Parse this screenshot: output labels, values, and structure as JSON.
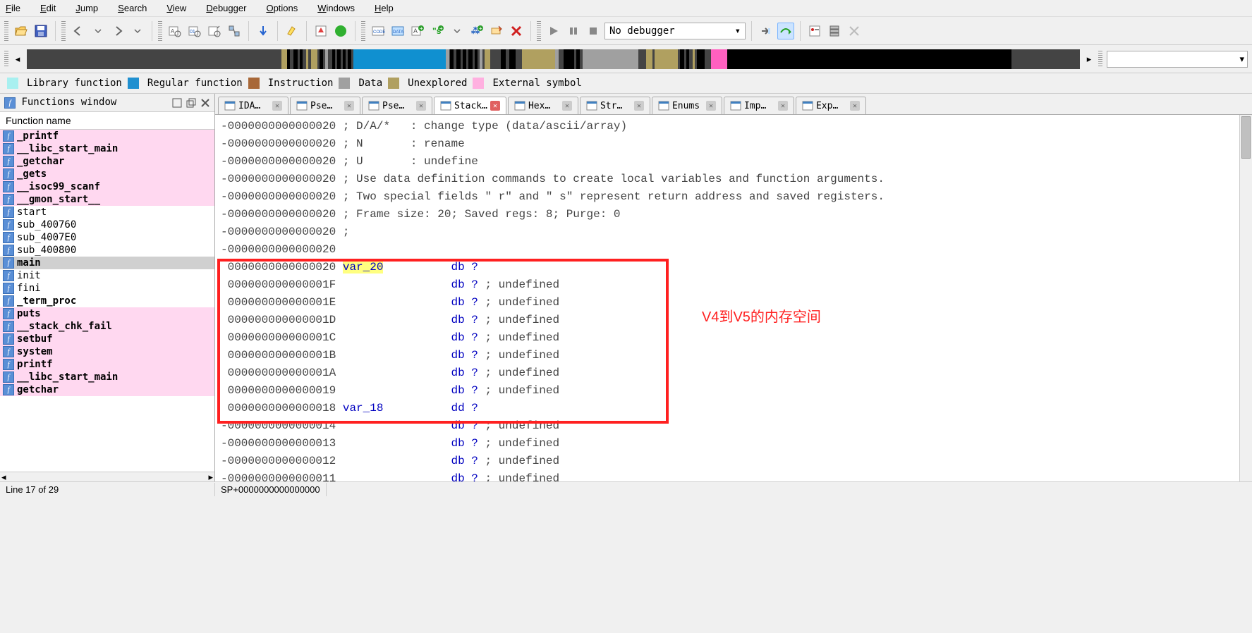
{
  "menu": [
    "File",
    "Edit",
    "Jump",
    "Search",
    "View",
    "Debugger",
    "Options",
    "Windows",
    "Help"
  ],
  "debugger_combo": "No debugger",
  "legend": [
    {
      "color": "#a8f0f0",
      "label": "Library function"
    },
    {
      "color": "#2090d0",
      "label": "Regular function"
    },
    {
      "color": "#a86838",
      "label": "Instruction"
    },
    {
      "color": "#a0a0a0",
      "label": "Data"
    },
    {
      "color": "#b0a060",
      "label": "Unexplored"
    },
    {
      "color": "#ffb0e0",
      "label": "External symbol"
    }
  ],
  "functions_panel": {
    "title": "Functions window",
    "header": "Function name"
  },
  "functions": [
    {
      "name": "_printf",
      "pink": true
    },
    {
      "name": "__libc_start_main",
      "pink": true
    },
    {
      "name": "_getchar",
      "pink": true
    },
    {
      "name": "_gets",
      "pink": true
    },
    {
      "name": "__isoc99_scanf",
      "pink": true
    },
    {
      "name": "__gmon_start__",
      "pink": true
    },
    {
      "name": "start",
      "pink": false
    },
    {
      "name": "sub_400760",
      "pink": false
    },
    {
      "name": "sub_4007E0",
      "pink": false
    },
    {
      "name": "sub_400800",
      "pink": false
    },
    {
      "name": "main",
      "pink": false,
      "sel": true
    },
    {
      "name": "init",
      "pink": false
    },
    {
      "name": "fini",
      "pink": false
    },
    {
      "name": "_term_proc",
      "pink": false
    },
    {
      "name": "puts",
      "pink": true
    },
    {
      "name": "__stack_chk_fail",
      "pink": true
    },
    {
      "name": "setbuf",
      "pink": true
    },
    {
      "name": "system",
      "pink": true
    },
    {
      "name": "printf",
      "pink": true
    },
    {
      "name": "__libc_start_main",
      "pink": true
    },
    {
      "name": "getchar",
      "pink": true
    }
  ],
  "tabs": [
    {
      "label": "IDA…",
      "icon": "ida"
    },
    {
      "label": "Pse…",
      "icon": "pse"
    },
    {
      "label": "Pse…",
      "icon": "pse"
    },
    {
      "label": "Stack…",
      "icon": "stack",
      "active": true
    },
    {
      "label": "Hex…",
      "icon": "hex"
    },
    {
      "label": "Str…",
      "icon": "str"
    },
    {
      "label": "Enums",
      "icon": "enum"
    },
    {
      "label": "Imp…",
      "icon": "imp"
    },
    {
      "label": "Exp…",
      "icon": "exp"
    }
  ],
  "code_lines": [
    {
      "addr": "-0000000000000020",
      "text": " ; D/A/*   : change type (data/ascii/array)"
    },
    {
      "addr": "-0000000000000020",
      "text": " ; N       : rename"
    },
    {
      "addr": "-0000000000000020",
      "text": " ; U       : undefine"
    },
    {
      "addr": "-0000000000000020",
      "text": " ; Use data definition commands to create local variables and function arguments."
    },
    {
      "addr": "-0000000000000020",
      "text": " ; Two special fields \" r\" and \" s\" represent return address and saved registers."
    },
    {
      "addr": "-0000000000000020",
      "text": " ; Frame size: 20; Saved regs: 8; Purge: 0"
    },
    {
      "addr": "-0000000000000020",
      "text": " ;"
    },
    {
      "addr": "-0000000000000020",
      "text": ""
    },
    {
      "addr": " 0000000000000020",
      "var": "var_20",
      "hl": true,
      "def": "db ?",
      "cmt": ""
    },
    {
      "addr": " 000000000000001F",
      "def": "db ?",
      "cmt": " ; undefined"
    },
    {
      "addr": " 000000000000001E",
      "def": "db ?",
      "cmt": " ; undefined"
    },
    {
      "addr": " 000000000000001D",
      "def": "db ?",
      "cmt": " ; undefined"
    },
    {
      "addr": " 000000000000001C",
      "def": "db ?",
      "cmt": " ; undefined"
    },
    {
      "addr": " 000000000000001B",
      "def": "db ?",
      "cmt": " ; undefined"
    },
    {
      "addr": " 000000000000001A",
      "def": "db ?",
      "cmt": " ; undefined"
    },
    {
      "addr": " 0000000000000019",
      "def": "db ?",
      "cmt": " ; undefined"
    },
    {
      "addr": " 0000000000000018",
      "var": "var_18",
      "def": "dd ?",
      "cmt": ""
    },
    {
      "addr": "-0000000000000014",
      "def": "db ?",
      "cmt": " ; undefined"
    },
    {
      "addr": "-0000000000000013",
      "def": "db ?",
      "cmt": " ; undefined"
    },
    {
      "addr": "-0000000000000012",
      "def": "db ?",
      "cmt": " ; undefined"
    },
    {
      "addr": "-0000000000000011",
      "def": "db ?",
      "cmt": " ; undefined"
    }
  ],
  "annotation": "V4到V5的内存空间",
  "status": {
    "left": "Line 17 of 29",
    "right": "SP+0000000000000000"
  },
  "nav_segments": [
    {
      "l": 0,
      "w": 24.2,
      "c": "#444"
    },
    {
      "l": 24.2,
      "w": 0.5,
      "c": "#b0a060"
    },
    {
      "l": 24.7,
      "w": 0.3,
      "c": "#000"
    },
    {
      "l": 25.3,
      "w": 0.4,
      "c": "#000"
    },
    {
      "l": 25.9,
      "w": 0.3,
      "c": "#000"
    },
    {
      "l": 26.5,
      "w": 0.2,
      "c": "#b0a060"
    },
    {
      "l": 27,
      "w": 0.6,
      "c": "#b0a060"
    },
    {
      "l": 27.8,
      "w": 0.3,
      "c": "#000"
    },
    {
      "l": 28.3,
      "w": 0.3,
      "c": "#a0a0a0"
    },
    {
      "l": 29,
      "w": 0.3,
      "c": "#000"
    },
    {
      "l": 29.5,
      "w": 0.3,
      "c": "#000"
    },
    {
      "l": 30,
      "w": 0.3,
      "c": "#000"
    },
    {
      "l": 30.5,
      "w": 0.3,
      "c": "#000"
    },
    {
      "l": 31,
      "w": 8.8,
      "c": "#1090d0"
    },
    {
      "l": 39.8,
      "w": 0.3,
      "c": "#a0a0a0"
    },
    {
      "l": 40.2,
      "w": 0.3,
      "c": "#000"
    },
    {
      "l": 40.8,
      "w": 0.4,
      "c": "#000"
    },
    {
      "l": 41.4,
      "w": 0.3,
      "c": "#000"
    },
    {
      "l": 41.9,
      "w": 0.4,
      "c": "#000"
    },
    {
      "l": 42.5,
      "w": 0.3,
      "c": "#000"
    },
    {
      "l": 43,
      "w": 0.3,
      "c": "#a0a0a0"
    },
    {
      "l": 43.5,
      "w": 0.5,
      "c": "#b0a060"
    },
    {
      "l": 45,
      "w": 0.5,
      "c": "#000"
    },
    {
      "l": 45.8,
      "w": 0.6,
      "c": "#000"
    },
    {
      "l": 47,
      "w": 3.2,
      "c": "#b0a060"
    },
    {
      "l": 50.2,
      "w": 0.3,
      "c": "#a0a0a0"
    },
    {
      "l": 51,
      "w": 1,
      "c": "#000"
    },
    {
      "l": 52.2,
      "w": 0.3,
      "c": "#000"
    },
    {
      "l": 52.8,
      "w": 5,
      "c": "#a0a0a0"
    },
    {
      "l": 57.8,
      "w": 0.3,
      "c": "#a0a0a0"
    },
    {
      "l": 58.8,
      "w": 0.6,
      "c": "#b0a060"
    },
    {
      "l": 59.6,
      "w": 2.2,
      "c": "#b0a060"
    },
    {
      "l": 62,
      "w": 0.4,
      "c": "#000"
    },
    {
      "l": 62.6,
      "w": 0.3,
      "c": "#000"
    },
    {
      "l": 63.2,
      "w": 0.2,
      "c": "#b0a060"
    },
    {
      "l": 63.6,
      "w": 0.8,
      "c": "#000"
    },
    {
      "l": 65,
      "w": 1.5,
      "c": "#ff60c0"
    },
    {
      "l": 66.5,
      "w": 27,
      "c": "#000"
    }
  ]
}
